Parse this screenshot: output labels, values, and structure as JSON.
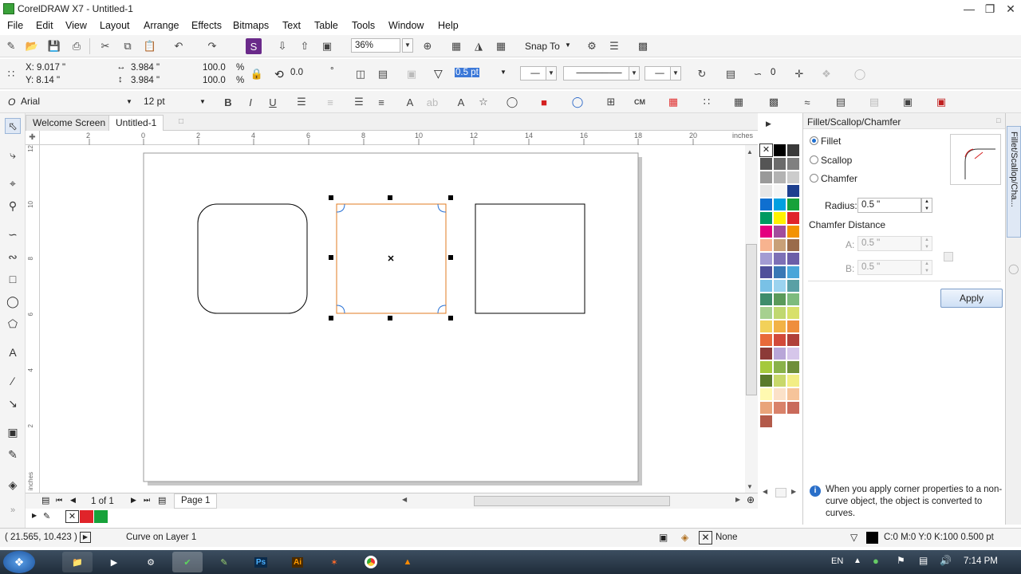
{
  "window": {
    "title": "CorelDRAW X7 - Untitled-1"
  },
  "menu": [
    "File",
    "Edit",
    "View",
    "Layout",
    "Arrange",
    "Effects",
    "Bitmaps",
    "Text",
    "Table",
    "Tools",
    "Window",
    "Help"
  ],
  "standard_toolbar": {
    "zoom": "36%",
    "snap_to": "Snap To"
  },
  "property_bar": {
    "x": "X: 9.017 \"",
    "y": "Y: 8.14 \"",
    "width": "3.984 \"",
    "height": "3.984 \"",
    "scale_x": "100.0",
    "scale_y": "100.0",
    "pct": "%",
    "rotation": "0.0",
    "outline_width": "0.5 pt",
    "corner_value": "0"
  },
  "text_bar": {
    "font": "Arial",
    "size": "12 pt"
  },
  "tabs": [
    "Welcome Screen",
    "Untitled-1"
  ],
  "ruler": {
    "units": "inches",
    "h_ticks": [
      "2",
      "0",
      "2",
      "4",
      "6",
      "8",
      "10",
      "12",
      "14",
      "16",
      "18",
      "20"
    ],
    "v_ticks": [
      "12",
      "10",
      "8",
      "6",
      "4",
      "2"
    ]
  },
  "page_nav": {
    "counter": "1 of 1",
    "page_tab": "Page 1"
  },
  "docker": {
    "title": "Fillet/Scallop/Chamfer",
    "options": [
      "Fillet",
      "Scallop",
      "Chamfer"
    ],
    "selected": "Fillet",
    "radius_label": "Radius:",
    "radius_value": "0.5 \"",
    "chamfer_heading": "Chamfer Distance",
    "a_label": "A:",
    "a_value": "0.5 \"",
    "b_label": "B:",
    "b_value": "0.5 \"",
    "apply": "Apply",
    "info": "When you apply corner properties to a non-curve object, the object is converted to curves.",
    "side_tab": "Fillet/Scallop/Cha..."
  },
  "palette_colors": [
    "#ffffff",
    "#000000",
    "#3a3a3a",
    "#555555",
    "#6b6b6b",
    "#808080",
    "#999999",
    "#b3b3b3",
    "#cccccc",
    "#e6e6e6",
    "#f5f5f5",
    "#1d3f8f",
    "#0f6fd0",
    "#00a0e0",
    "#17a23a",
    "#009a60",
    "#fff200",
    "#e0242a",
    "#e4007f",
    "#a24d9c",
    "#f39200",
    "#f7b38f",
    "#c8a078",
    "#9a6b4b",
    "#a39bd3",
    "#7d70b6",
    "#6c5fa8",
    "#4f4f9a",
    "#3978b5",
    "#4aa6d9",
    "#79c1e6",
    "#9bd3ef",
    "#5aa0a5",
    "#3d8c6b",
    "#5a9a5a",
    "#7dbb7d",
    "#a6d08f",
    "#c0d870",
    "#d8e06a",
    "#f2d15a",
    "#f2b246",
    "#ef8e3d",
    "#e86a3a",
    "#d24a3a",
    "#b0403a",
    "#8c3a38",
    "#b8a6d8",
    "#d6c6ea",
    "#a5c93c",
    "#8ab24a",
    "#6f8f3a",
    "#5a7a2a",
    "#c8d86a",
    "#f3ee85",
    "#fff9b0",
    "#fbe1c8",
    "#f6c49a",
    "#e9a47a",
    "#d9826a",
    "#c96a5a",
    "#b35a4a"
  ],
  "status": {
    "coords": "( 21.565, 10.423 )",
    "object": "Curve on Layer 1",
    "fill": "None",
    "outline": "C:0 M:0 Y:0 K:100  0.500 pt"
  },
  "tray": {
    "lang": "EN",
    "time": "7:14 PM"
  }
}
